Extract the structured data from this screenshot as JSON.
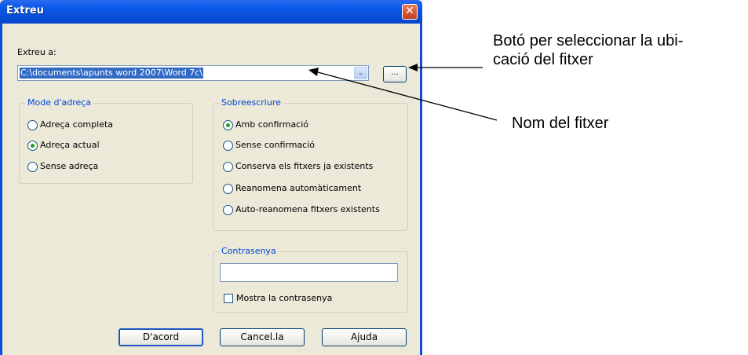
{
  "dialog": {
    "title": "Extreu",
    "close_glyph": "✕",
    "extract_label": "Extreu a:",
    "path_value": "C:\\documents\\apunts word 2007\\Word 7c\\",
    "combo_arrow_glyph": "⌄",
    "browse_label": "..."
  },
  "mode_group": {
    "legend": "Mode d'adreça",
    "options": [
      {
        "label": "Adreça completa",
        "selected": false
      },
      {
        "label": "Adreça actual",
        "selected": true
      },
      {
        "label": "Sense adreça",
        "selected": false
      }
    ]
  },
  "overwrite_group": {
    "legend": "Sobreescriure",
    "options": [
      {
        "label": "Amb confirmació",
        "selected": true
      },
      {
        "label": "Sense confirmació",
        "selected": false
      },
      {
        "label": "Conserva els fitxers ja existents",
        "selected": false
      },
      {
        "label": "Reanomena automàticament",
        "selected": false
      },
      {
        "label": "Auto-reanomena fitxers existents",
        "selected": false
      }
    ]
  },
  "password_group": {
    "legend": "Contrasenya",
    "value": "",
    "show_label": "Mostra la contrasenya",
    "show_checked": false
  },
  "buttons": {
    "ok": "D'acord",
    "cancel": "Cancel.la",
    "help": "Ajuda"
  },
  "annotations": {
    "browse_line1": "Botó per seleccionar la ubi-",
    "browse_line2": "cació del fitxer",
    "name": "Nom del fitxer"
  }
}
